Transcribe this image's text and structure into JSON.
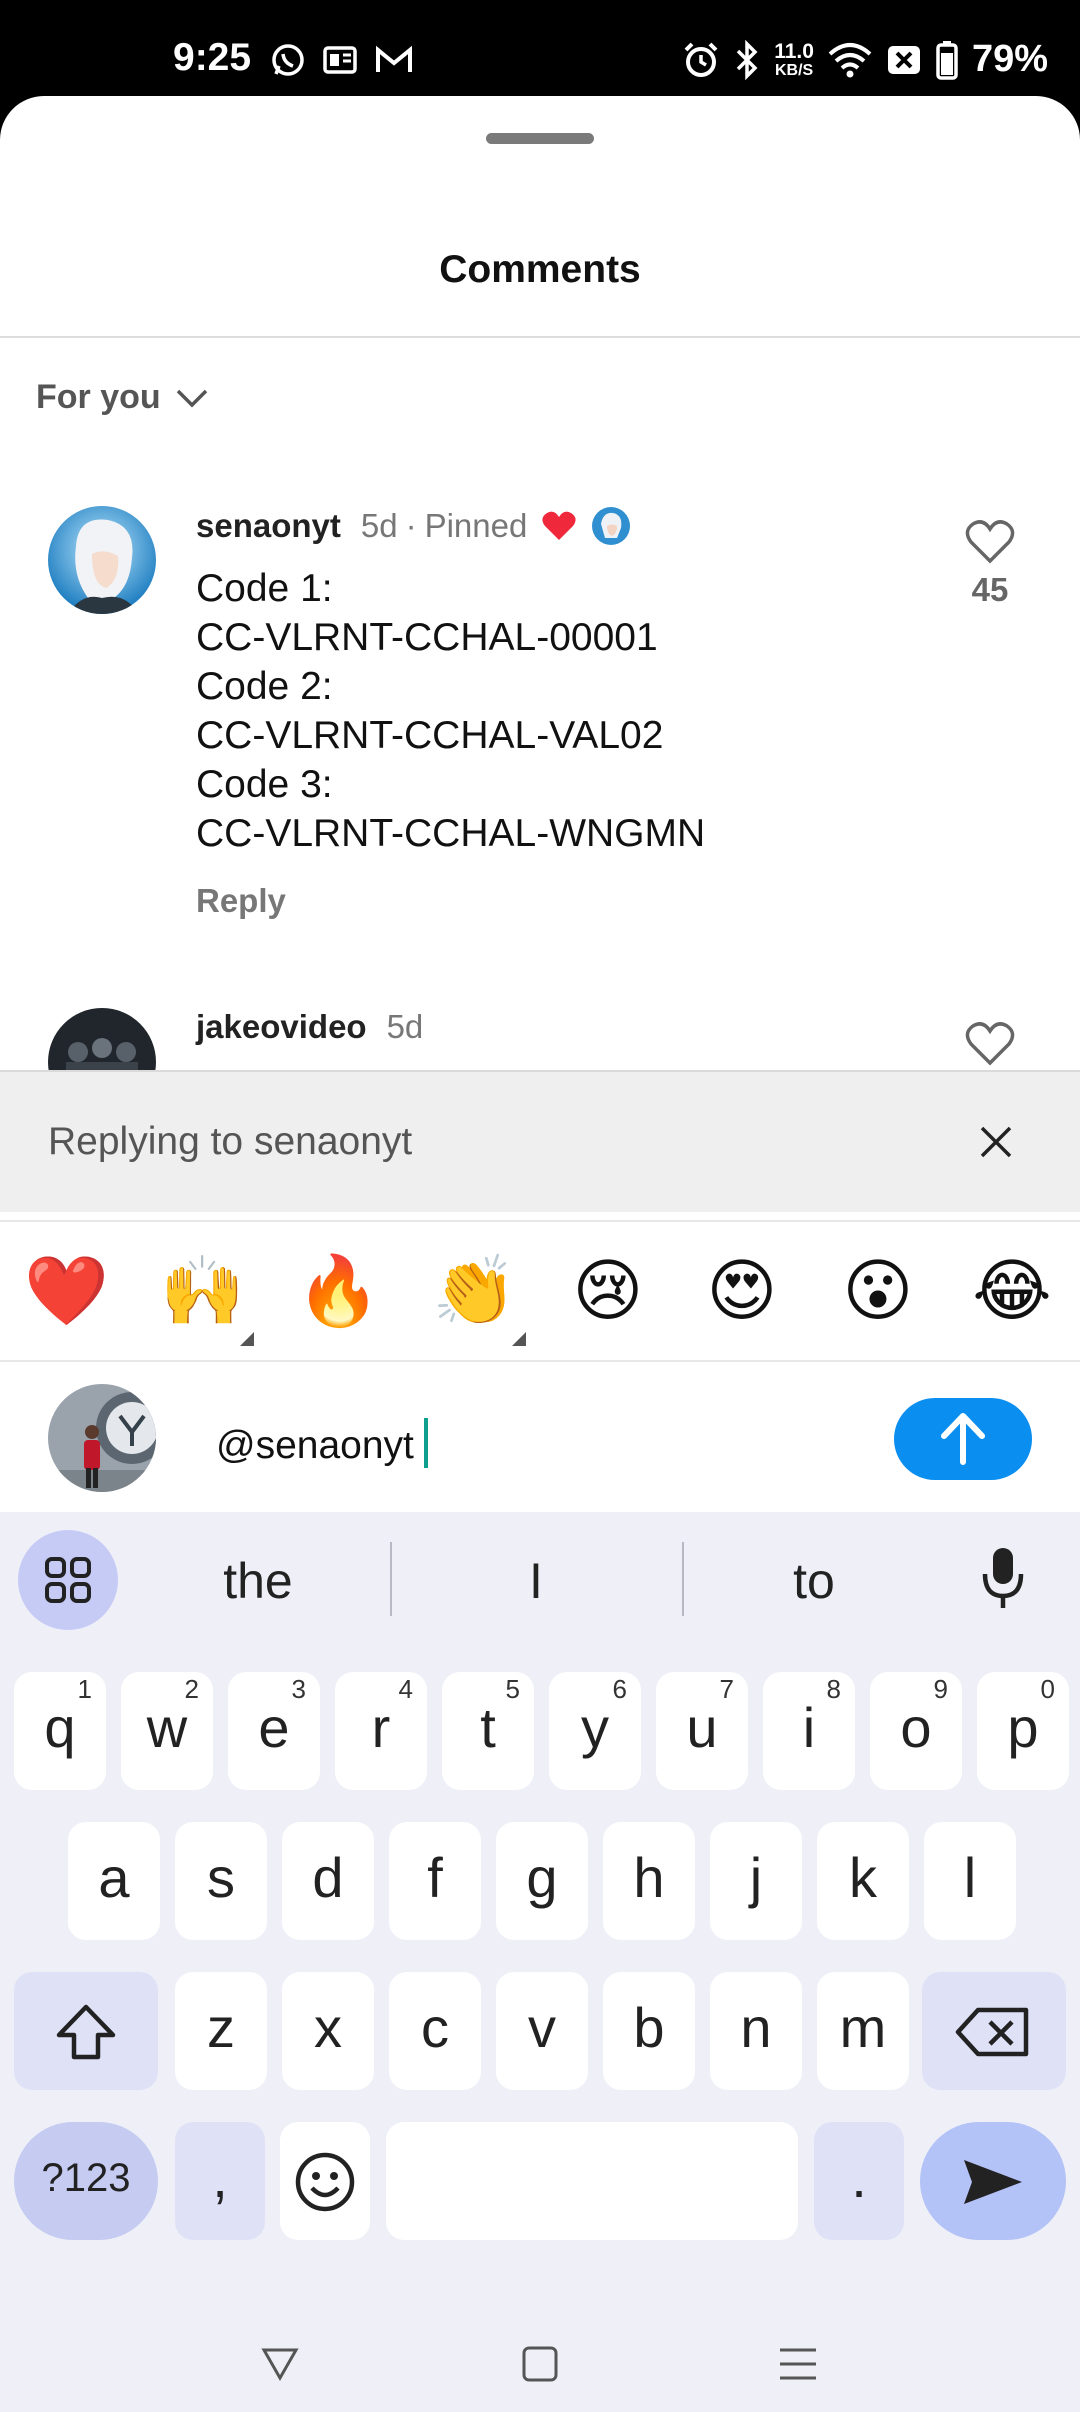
{
  "status": {
    "time": "9:25",
    "speed_value": "11.0",
    "speed_unit": "KB/S",
    "battery": "79%"
  },
  "sheet": {
    "title": "Comments",
    "filter_label": "For you"
  },
  "comments": [
    {
      "user": "senaonyt",
      "age": "5d",
      "separator": "·",
      "pinned_label": "Pinned",
      "lines": [
        "Code 1:",
        "CC-VLRNT-CCHAL-00001",
        "Code 2:",
        "CC-VLRNT-CCHAL-VAL02",
        "Code 3:",
        "CC-VLRNT-CCHAL-WNGMN"
      ],
      "reply_label": "Reply",
      "likes": "45"
    },
    {
      "user": "jakeovideo",
      "age": "5d"
    }
  ],
  "reply_bar": {
    "text": "Replying to senaonyt"
  },
  "emoji_bar": [
    "❤️",
    "🙌",
    "🔥",
    "👏",
    "😢",
    "😍",
    "😮",
    "😂"
  ],
  "composer": {
    "value": "@senaonyt"
  },
  "keyboard": {
    "suggestions": [
      "the",
      "I",
      "to"
    ],
    "row1": [
      [
        "q",
        "1"
      ],
      [
        "w",
        "2"
      ],
      [
        "e",
        "3"
      ],
      [
        "r",
        "4"
      ],
      [
        "t",
        "5"
      ],
      [
        "y",
        "6"
      ],
      [
        "u",
        "7"
      ],
      [
        "i",
        "8"
      ],
      [
        "o",
        "9"
      ],
      [
        "p",
        "0"
      ]
    ],
    "row2": [
      "a",
      "s",
      "d",
      "f",
      "g",
      "h",
      "j",
      "k",
      "l"
    ],
    "row3": [
      "z",
      "x",
      "c",
      "v",
      "b",
      "n",
      "m"
    ],
    "symbols_label": "?123",
    "comma": ",",
    "period": "."
  },
  "colors": {
    "accent_blue": "#0A8EF0",
    "heart_red": "#F0283C",
    "cursor_teal": "#0E9F8E",
    "keyboard_bg": "#EFF0F7"
  }
}
